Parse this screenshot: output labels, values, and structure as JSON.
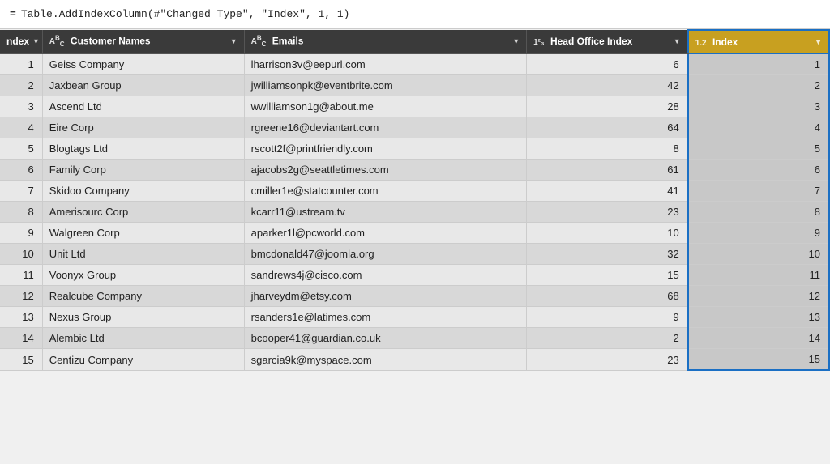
{
  "formula_bar": {
    "equals": "=",
    "formula": "Table.AddIndexColumn(#\"Changed Type\", \"Index\", 1, 1)"
  },
  "columns": [
    {
      "id": "index",
      "type_icon": "",
      "label": "ndex",
      "class": "col-index"
    },
    {
      "id": "customer_names",
      "type_icon": "Aᵇᶜ",
      "label": "Customer Names",
      "class": "col-names"
    },
    {
      "id": "emails",
      "type_icon": "Aᵇᶜ",
      "label": "Emails",
      "class": "col-emails"
    },
    {
      "id": "head_office_index",
      "type_icon": "1²₃",
      "label": "Head Office Index",
      "class": "col-hoi"
    },
    {
      "id": "idx",
      "type_icon": "1.2",
      "label": "Index",
      "class": "col-idx"
    }
  ],
  "rows": [
    {
      "row": 1,
      "name": "Geiss Company",
      "email": "lharrison3v@eepurl.com",
      "hoi": "6",
      "idx": 1
    },
    {
      "row": 2,
      "name": "Jaxbean Group",
      "email": "jwilliamsonpk@eventbrite.com",
      "hoi": "42",
      "idx": 2
    },
    {
      "row": 3,
      "name": "Ascend Ltd",
      "email": "wwilliamson1g@about.me",
      "hoi": "28",
      "idx": 3
    },
    {
      "row": 4,
      "name": "Eire Corp",
      "email": "rgreene16@deviantart.com",
      "hoi": "64",
      "idx": 4
    },
    {
      "row": 5,
      "name": "Blogtags Ltd",
      "email": "rscott2f@printfriendly.com",
      "hoi": "8",
      "idx": 5
    },
    {
      "row": 6,
      "name": "Family Corp",
      "email": "ajacobs2g@seattletimes.com",
      "hoi": "61",
      "idx": 6
    },
    {
      "row": 7,
      "name": "Skidoo Company",
      "email": "cmiller1e@statcounter.com",
      "hoi": "41",
      "idx": 7
    },
    {
      "row": 8,
      "name": "Amerisourc Corp",
      "email": "kcarr11@ustream.tv",
      "hoi": "23",
      "idx": 8
    },
    {
      "row": 9,
      "name": "Walgreen Corp",
      "email": "aparker1l@pcworld.com",
      "hoi": "10",
      "idx": 9
    },
    {
      "row": 10,
      "name": "Unit Ltd",
      "email": "bmcdonald47@joomla.org",
      "hoi": "32",
      "idx": 10
    },
    {
      "row": 11,
      "name": "Voonyx Group",
      "email": "sandrews4j@cisco.com",
      "hoi": "15",
      "idx": 11
    },
    {
      "row": 12,
      "name": "Realcube Company",
      "email": "jharveydm@etsy.com",
      "hoi": "68",
      "idx": 12
    },
    {
      "row": 13,
      "name": "Nexus Group",
      "email": "rsanders1e@latimes.com",
      "hoi": "9",
      "idx": 13
    },
    {
      "row": 14,
      "name": "Alembic Ltd",
      "email": "bcooper41@guardian.co.uk",
      "hoi": "2",
      "idx": 14
    },
    {
      "row": 15,
      "name": "Centizu Company",
      "email": "sgarcia9k@myspace.com",
      "hoi": "23",
      "idx": 15
    }
  ]
}
